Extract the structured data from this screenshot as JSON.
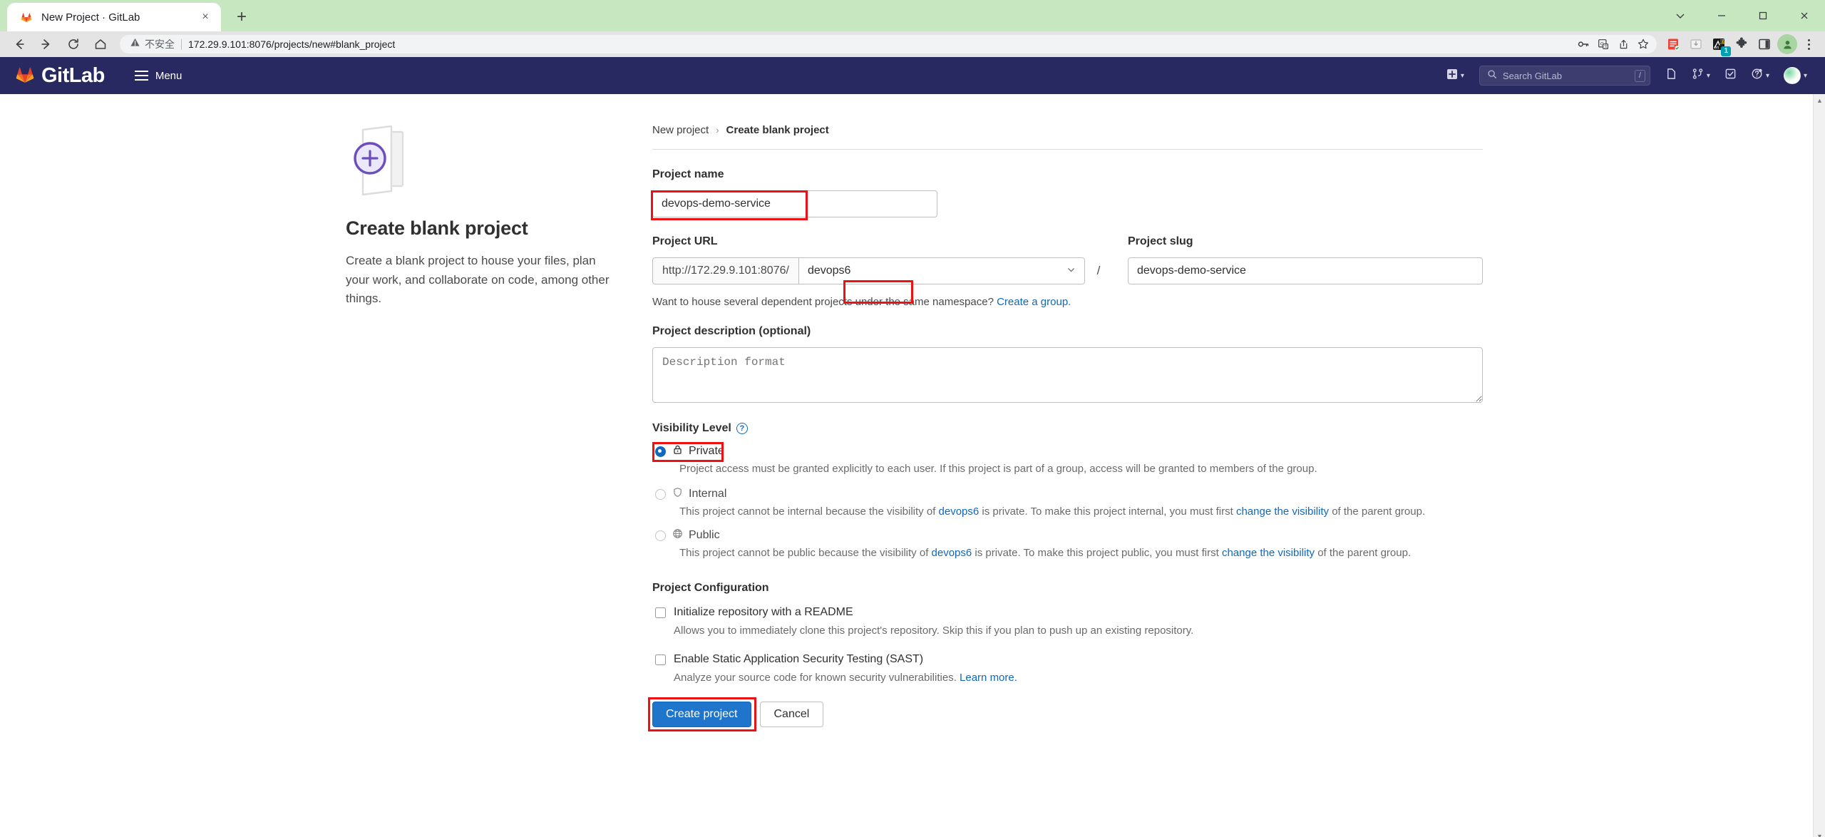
{
  "browser": {
    "tab": {
      "title": "New Project · GitLab",
      "favicon": "gitlab-fox-icon",
      "close": "×"
    },
    "new_tab_label": "+",
    "window_controls": {
      "minimize": "—",
      "maximize": "□",
      "close": "×",
      "chevron": "⌄"
    },
    "nav": {
      "back": "←",
      "forward": "→",
      "reload": "⟳",
      "home": "⌂"
    },
    "omnibox": {
      "warning_icon": "warning-triangle-icon",
      "warning_text": "不安全",
      "url": "172.29.9.101:8076/projects/new#blank_project",
      "icons": [
        "key-icon",
        "translate-icon",
        "share-icon",
        "bookmark-star-icon"
      ]
    },
    "extensions": [
      {
        "name": "notes-extension-icon",
        "badge": ""
      },
      {
        "name": "download-extension-icon",
        "badge": ""
      },
      {
        "name": "translate-extension-icon",
        "badge": "1"
      },
      {
        "name": "puzzle-extensions-icon",
        "badge": ""
      },
      {
        "name": "sidebar-panel-icon",
        "badge": ""
      }
    ],
    "profile_icon": "profile-avatar-icon",
    "menu_icon": "three-dots-menu-icon"
  },
  "gitlab_header": {
    "brand": "GitLab",
    "menu_label": "Menu",
    "new_dropdown_icon": "plus-square-icon",
    "search": {
      "placeholder": "Search GitLab",
      "shortcut": "/"
    },
    "icons": [
      {
        "name": "issues-icon"
      },
      {
        "name": "merge-requests-icon"
      },
      {
        "name": "todos-icon"
      },
      {
        "name": "help-icon"
      },
      {
        "name": "user-avatar-icon"
      }
    ]
  },
  "left_panel": {
    "illustration": "blank-project-folder-icon",
    "title": "Create blank project",
    "description": "Create a blank project to house your files, plan your work, and collaborate on code, among other things."
  },
  "breadcrumb": {
    "parent": "New project",
    "separator": "›",
    "current": "Create blank project"
  },
  "form": {
    "project_name": {
      "label": "Project name",
      "value": "devops-demo-service",
      "placeholder": ""
    },
    "project_url": {
      "label": "Project URL",
      "prefix": "http://172.29.9.101:8076/",
      "namespace": "devops6",
      "separator": "/",
      "chevron": "⌄"
    },
    "project_slug": {
      "label": "Project slug",
      "value": "devops-demo-service"
    },
    "namespace_hint": {
      "text": "Want to house several dependent projects under the same namespace?",
      "link": "Create a group."
    },
    "project_description": {
      "label": "Project description (optional)",
      "placeholder": "Description format",
      "value": ""
    },
    "visibility": {
      "label": "Visibility Level",
      "help_icon": "question-mark-icon",
      "options": [
        {
          "name": "Private",
          "icon": "lock-icon",
          "selected": true,
          "disabled": false,
          "description": "Project access must be granted explicitly to each user. If this project is part of a group, access will be granted to members of the group."
        },
        {
          "name": "Internal",
          "icon": "shield-icon",
          "selected": false,
          "disabled": true,
          "desc_part1": "This project cannot be internal because the visibility of ",
          "desc_link1": "devops6",
          "desc_part2": " is private. To make this project internal, you must first ",
          "desc_link2": "change the visibility",
          "desc_part3": " of the parent group."
        },
        {
          "name": "Public",
          "icon": "globe-icon",
          "selected": false,
          "disabled": true,
          "desc_part1": "This project cannot be public because the visibility of ",
          "desc_link1": "devops6",
          "desc_part2": " is private. To make this project public, you must first ",
          "desc_link2": "change the visibility",
          "desc_part3": " of the parent group."
        }
      ]
    },
    "configuration": {
      "label": "Project Configuration",
      "readme": {
        "label": "Initialize repository with a README",
        "checked": false,
        "description": "Allows you to immediately clone this project's repository. Skip this if you plan to push up an existing repository."
      },
      "sast": {
        "label": "Enable Static Application Security Testing (SAST)",
        "checked": false,
        "description": "Analyze your source code for known security vulnerabilities.",
        "link": "Learn more."
      }
    },
    "actions": {
      "submit": "Create project",
      "cancel": "Cancel"
    }
  },
  "colors": {
    "gitlab_navy": "#292961",
    "primary_button": "#1f75cb",
    "link": "#1068bf",
    "annotation": "#ee1111",
    "tab_strip": "#c7e7c0"
  }
}
